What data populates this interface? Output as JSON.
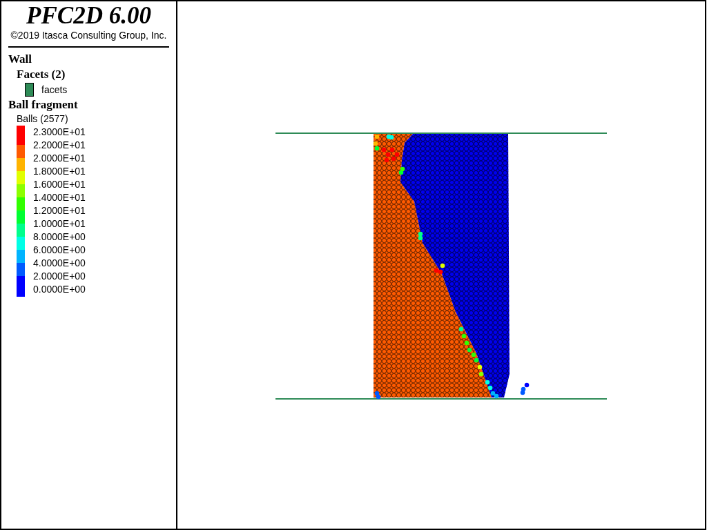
{
  "header": {
    "title": "PFC2D 6.00",
    "copyright": "©2019 Itasca Consulting Group, Inc."
  },
  "legend": {
    "wall": {
      "heading": "Wall",
      "group": "Facets (2)",
      "items": [
        {
          "label": "facets",
          "color": "#2e8b57"
        }
      ]
    },
    "balls": {
      "heading": "Ball fragment",
      "group": "Balls (2577)",
      "bands": [
        {
          "color": "#ff0000"
        },
        {
          "color": "#ff5a00"
        },
        {
          "color": "#ffb400"
        },
        {
          "color": "#e1ff00"
        },
        {
          "color": "#8cff00"
        },
        {
          "color": "#32ff00"
        },
        {
          "color": "#00ff32"
        },
        {
          "color": "#00ff8c"
        },
        {
          "color": "#00ffe6"
        },
        {
          "color": "#00b4ff"
        },
        {
          "color": "#005aff"
        },
        {
          "color": "#0000ff"
        }
      ],
      "labels": [
        "2.3000E+01",
        "2.2000E+01",
        "2.0000E+01",
        "1.8000E+01",
        "1.6000E+01",
        "1.4000E+01",
        "1.2000E+01",
        "1.0000E+01",
        "8.0000E+00",
        "6.0000E+00",
        "4.0000E+00",
        "2.0000E+00",
        "0.0000E+00"
      ]
    }
  }
}
